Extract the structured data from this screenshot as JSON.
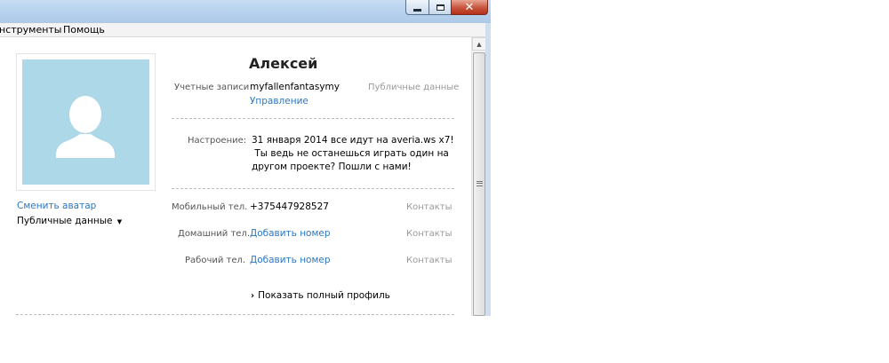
{
  "menubar": {
    "items": [
      "нструменты",
      "Помощь"
    ]
  },
  "profile": {
    "name": "Алексей",
    "change_avatar": "Сменить аватар",
    "public_data_dropdown": "Публичные данные",
    "accounts": {
      "label": "Учетные записи",
      "value": "myfallenfantasymy",
      "manage_link": "Управление",
      "visibility": "Публичные данные"
    },
    "mood": {
      "label": "Настроение:",
      "lines": [
        "31 января 2014 все идут на averia.ws x7!",
        " Ты ведь не останешься играть один на",
        "другом проекте? Пошли с нами!"
      ]
    },
    "phones": [
      {
        "label": "Мобильный тел.",
        "value": "+375447928527",
        "is_link": false,
        "visibility": "Контакты"
      },
      {
        "label": "Домашний тел.",
        "value": "Добавить номер",
        "is_link": true,
        "visibility": "Контакты"
      },
      {
        "label": "Рабочий тел.",
        "value": "Добавить номер",
        "is_link": true,
        "visibility": "Контакты"
      }
    ],
    "show_full_profile": "Показать полный профиль"
  },
  "icons": {
    "avatar": "person-silhouette-icon",
    "dropdown": "caret-down-icon",
    "expand": "chevron-right-icon"
  },
  "colors": {
    "link": "#2a77c4",
    "avatar_bg": "#add8e8",
    "title_bar": "#b7d2ee"
  }
}
